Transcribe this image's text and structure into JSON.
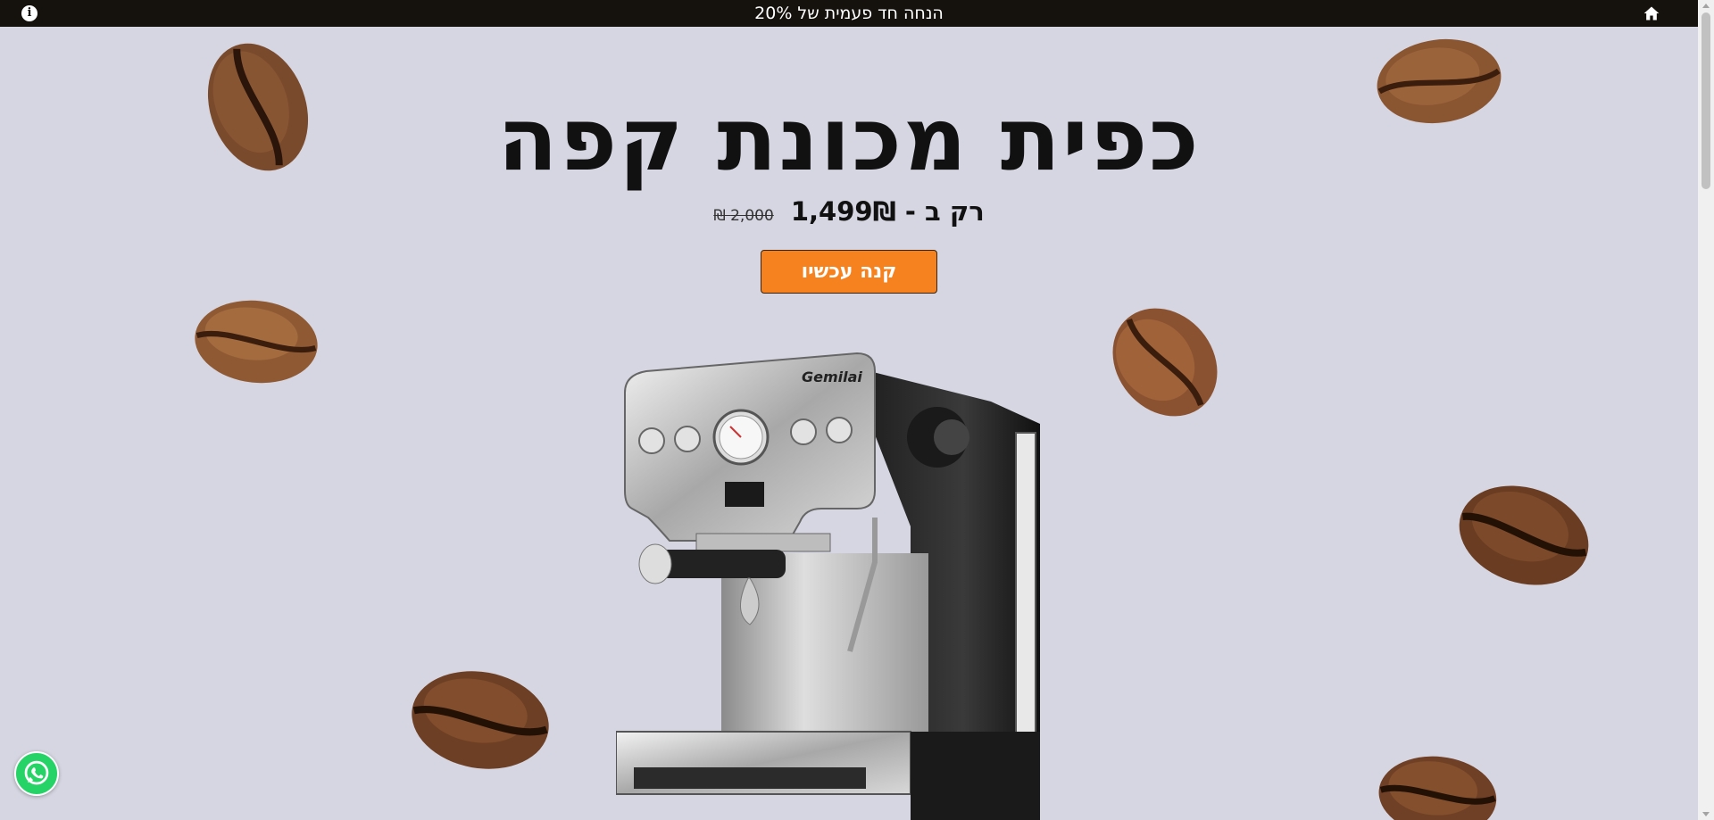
{
  "topbar": {
    "promo_text": "הנחה חד פעמית של 20%",
    "info_icon": "info-icon",
    "home_icon": "home-icon",
    "background": "#15120d"
  },
  "hero": {
    "title": "כפית מכונת קפה",
    "price_now": "רק ב - 1,499₪",
    "price_old": "2,000 ₪",
    "buy_button": "קנה עכשיו",
    "button_color": "#f5821f",
    "background": "#d6d6e2",
    "machine_brand": "Gemilai"
  },
  "floating": {
    "whatsapp_icon": "whatsapp-icon"
  }
}
